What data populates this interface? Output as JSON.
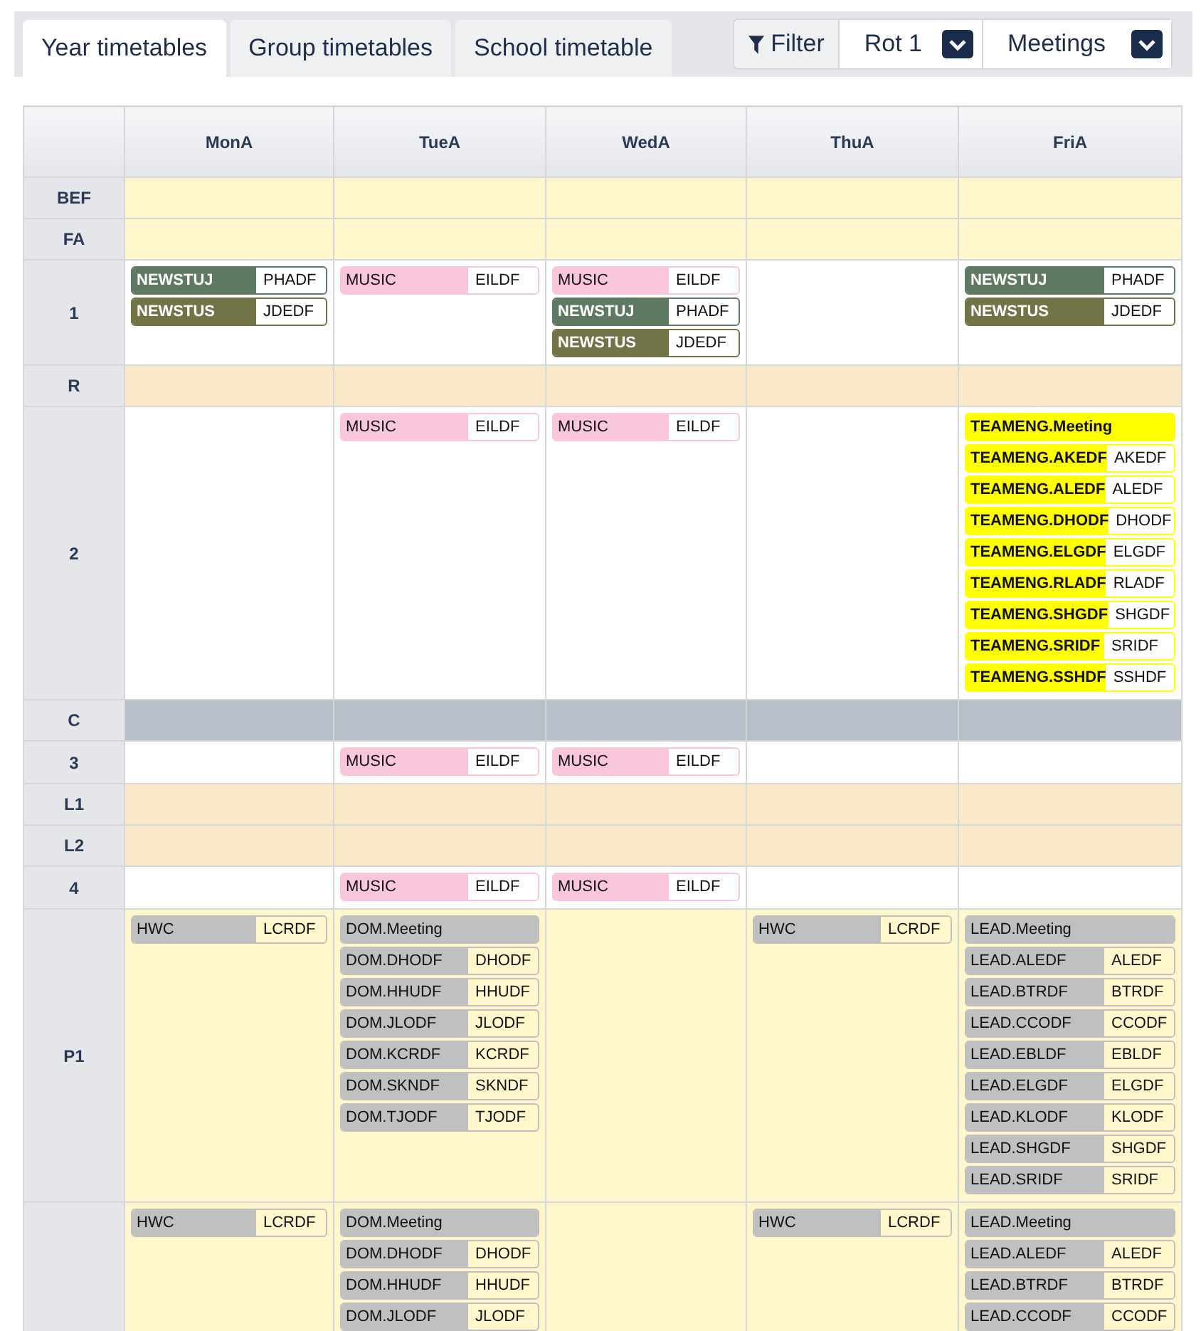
{
  "tabs": [
    {
      "label": "Year timetables",
      "selected": true
    },
    {
      "label": "Group timetables",
      "selected": false
    },
    {
      "label": "School timetable",
      "selected": false
    }
  ],
  "filter": {
    "label": "Filter"
  },
  "dropdowns": [
    {
      "value": "Rot 1"
    },
    {
      "value": "Meetings"
    }
  ],
  "table": {
    "columns": [
      "MonA",
      "TueA",
      "WedA",
      "ThuA",
      "FriA"
    ],
    "rows": [
      {
        "label": "BEF",
        "kind": "before",
        "cells": [
          [],
          [],
          [],
          [],
          []
        ]
      },
      {
        "label": "FA",
        "kind": "before",
        "cells": [
          [],
          [],
          [],
          [],
          []
        ]
      },
      {
        "label": "1",
        "kind": "lesson",
        "cells": [
          [
            {
              "code": "NEWSTUJ",
              "room": "PHADF",
              "kind": "newstuj"
            },
            {
              "code": "NEWSTUS",
              "room": "JDEDF",
              "kind": "newstus"
            }
          ],
          [
            {
              "code": "MUSIC",
              "room": "EILDF",
              "kind": "music"
            }
          ],
          [
            {
              "code": "MUSIC",
              "room": "EILDF",
              "kind": "music"
            },
            {
              "code": "NEWSTUJ",
              "room": "PHADF",
              "kind": "newstuj"
            },
            {
              "code": "NEWSTUS",
              "room": "JDEDF",
              "kind": "newstus"
            }
          ],
          [],
          [
            {
              "code": "NEWSTUJ",
              "room": "PHADF",
              "kind": "newstuj"
            },
            {
              "code": "NEWSTUS",
              "room": "JDEDF",
              "kind": "newstus"
            }
          ]
        ]
      },
      {
        "label": "R",
        "kind": "recess",
        "cells": [
          [],
          [],
          [],
          [],
          []
        ]
      },
      {
        "label": "2",
        "kind": "lesson",
        "cells": [
          [],
          [
            {
              "code": "MUSIC",
              "room": "EILDF",
              "kind": "music"
            }
          ],
          [
            {
              "code": "MUSIC",
              "room": "EILDF",
              "kind": "music"
            }
          ],
          [],
          [
            {
              "code": "TEAMENG.Meeting",
              "kind": "team"
            },
            {
              "code": "TEAMENG.AKEDF",
              "room": "AKEDF",
              "kind": "team"
            },
            {
              "code": "TEAMENG.ALEDF",
              "room": "ALEDF",
              "kind": "team"
            },
            {
              "code": "TEAMENG.DHODF",
              "room": "DHODF",
              "kind": "team"
            },
            {
              "code": "TEAMENG.ELGDF",
              "room": "ELGDF",
              "kind": "team"
            },
            {
              "code": "TEAMENG.RLADF",
              "room": "RLADF",
              "kind": "team"
            },
            {
              "code": "TEAMENG.SHGDF",
              "room": "SHGDF",
              "kind": "team"
            },
            {
              "code": "TEAMENG.SRIDF",
              "room": "SRIDF",
              "kind": "team"
            },
            {
              "code": "TEAMENG.SSHDF",
              "room": "SSHDF",
              "kind": "team"
            }
          ]
        ]
      },
      {
        "label": "C",
        "kind": "changeover",
        "cells": [
          [],
          [],
          [],
          [],
          []
        ]
      },
      {
        "label": "3",
        "kind": "lesson",
        "cells": [
          [],
          [
            {
              "code": "MUSIC",
              "room": "EILDF",
              "kind": "music"
            }
          ],
          [
            {
              "code": "MUSIC",
              "room": "EILDF",
              "kind": "music"
            }
          ],
          [],
          []
        ]
      },
      {
        "label": "L1",
        "kind": "recess",
        "cells": [
          [],
          [],
          [],
          [],
          []
        ]
      },
      {
        "label": "L2",
        "kind": "recess",
        "cells": [
          [],
          [],
          [],
          [],
          []
        ]
      },
      {
        "label": "4",
        "kind": "lesson",
        "cells": [
          [],
          [
            {
              "code": "MUSIC",
              "room": "EILDF",
              "kind": "music"
            }
          ],
          [
            {
              "code": "MUSIC",
              "room": "EILDF",
              "kind": "music"
            }
          ],
          [],
          []
        ]
      },
      {
        "label": "P1",
        "kind": "after",
        "cells": [
          [
            {
              "code": "HWC",
              "room": "LCRDF",
              "kind": "staff"
            }
          ],
          [
            {
              "code": "DOM.Meeting",
              "kind": "staff"
            },
            {
              "code": "DOM.DHODF",
              "room": "DHODF",
              "kind": "staff"
            },
            {
              "code": "DOM.HHUDF",
              "room": "HHUDF",
              "kind": "staff"
            },
            {
              "code": "DOM.JLODF",
              "room": "JLODF",
              "kind": "staff"
            },
            {
              "code": "DOM.KCRDF",
              "room": "KCRDF",
              "kind": "staff"
            },
            {
              "code": "DOM.SKNDF",
              "room": "SKNDF",
              "kind": "staff"
            },
            {
              "code": "DOM.TJODF",
              "room": "TJODF",
              "kind": "staff"
            }
          ],
          [],
          [
            {
              "code": "HWC",
              "room": "LCRDF",
              "kind": "staff"
            }
          ],
          [
            {
              "code": "LEAD.Meeting",
              "kind": "staff"
            },
            {
              "code": "LEAD.ALEDF",
              "room": "ALEDF",
              "kind": "staff"
            },
            {
              "code": "LEAD.BTRDF",
              "room": "BTRDF",
              "kind": "staff"
            },
            {
              "code": "LEAD.CCODF",
              "room": "CCODF",
              "kind": "staff"
            },
            {
              "code": "LEAD.EBLDF",
              "room": "EBLDF",
              "kind": "staff"
            },
            {
              "code": "LEAD.ELGDF",
              "room": "ELGDF",
              "kind": "staff"
            },
            {
              "code": "LEAD.KLODF",
              "room": "KLODF",
              "kind": "staff"
            },
            {
              "code": "LEAD.SHGDF",
              "room": "SHGDF",
              "kind": "staff"
            },
            {
              "code": "LEAD.SRIDF",
              "room": "SRIDF",
              "kind": "staff"
            }
          ]
        ]
      },
      {
        "kind": "after",
        "cells": [
          [
            {
              "code": "HWC",
              "room": "LCRDF",
              "kind": "staff"
            }
          ],
          [
            {
              "code": "DOM.Meeting",
              "kind": "staff"
            },
            {
              "code": "DOM.DHODF",
              "room": "DHODF",
              "kind": "staff"
            },
            {
              "code": "DOM.HHUDF",
              "room": "HHUDF",
              "kind": "staff"
            },
            {
              "code": "DOM.JLODF",
              "room": "JLODF",
              "kind": "staff"
            }
          ],
          [],
          [
            {
              "code": "HWC",
              "room": "LCRDF",
              "kind": "staff"
            }
          ],
          [
            {
              "code": "LEAD.Meeting",
              "kind": "staff"
            },
            {
              "code": "LEAD.ALEDF",
              "room": "ALEDF",
              "kind": "staff"
            },
            {
              "code": "LEAD.BTRDF",
              "room": "BTRDF",
              "kind": "staff"
            },
            {
              "code": "LEAD.CCODF",
              "room": "CCODF",
              "kind": "staff"
            }
          ]
        ]
      }
    ]
  }
}
